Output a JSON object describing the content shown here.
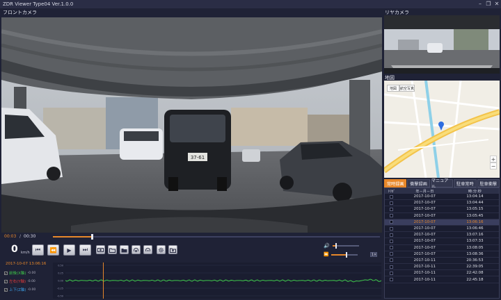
{
  "window": {
    "title": "ZDR Viewer Type04 Ver.1.0.0",
    "controls": {
      "minimize": "–",
      "restore": "❐",
      "close": "✕"
    }
  },
  "labels": {
    "front_camera": "フロントカメラ",
    "rear_camera": "リヤカメラ",
    "map": "地図"
  },
  "map": {
    "tab_map": "地図",
    "tab_satellite": "航空写真",
    "zoom_in": "+",
    "zoom_out": "−",
    "pin_color": "#2f6ee0"
  },
  "front_view": {
    "plate_text": "37-61"
  },
  "playback": {
    "current_time": "00:03",
    "separator": "/",
    "total_time": "00:30",
    "progress": 0.12,
    "speed": "0",
    "speed_unit": "km/h",
    "volume": 0.12,
    "rate": 0.55,
    "rate_label": "1×"
  },
  "buttons": {
    "prev": "⏮",
    "step_back": "⏪",
    "play": "▶",
    "next": "⏭"
  },
  "tabs": [
    {
      "label": "常時録画",
      "active": true
    },
    {
      "label": "衝撃録画",
      "active": false
    },
    {
      "label": "マニュアル",
      "active": false
    },
    {
      "label": "駐車常時",
      "active": false
    },
    {
      "label": "駐車衝撃",
      "active": false
    }
  ],
  "table": {
    "headers": [
      "ﾄﾘｶﾞ",
      "年－月－日",
      "時:分:秒"
    ],
    "rows": [
      {
        "date": "2017-10-07",
        "time": "13:04:14",
        "selected": false
      },
      {
        "date": "2017-10-07",
        "time": "13:04:44",
        "selected": false
      },
      {
        "date": "2017-10-07",
        "time": "13:05:15",
        "selected": false
      },
      {
        "date": "2017-10-07",
        "time": "13:05:45",
        "selected": false
      },
      {
        "date": "2017-10-07",
        "time": "13:06:16",
        "selected": true
      },
      {
        "date": "2017-10-07",
        "time": "13:06:46",
        "selected": false
      },
      {
        "date": "2017-10-07",
        "time": "13:07:16",
        "selected": false
      },
      {
        "date": "2017-10-07",
        "time": "13:07:33",
        "selected": false
      },
      {
        "date": "2017-10-07",
        "time": "13:08:05",
        "selected": false
      },
      {
        "date": "2017-10-07",
        "time": "13:08:36",
        "selected": false
      },
      {
        "date": "2017-10-11",
        "time": "20:36:53",
        "selected": false
      },
      {
        "date": "2017-10-11",
        "time": "22:39:05",
        "selected": false
      },
      {
        "date": "2017-10-11",
        "time": "22:42:08",
        "selected": false
      },
      {
        "date": "2017-10-11",
        "time": "22:45:18",
        "selected": false
      }
    ]
  },
  "sensor": {
    "datetime": "2017-10-07 13:06:16",
    "legend": [
      {
        "label": "前後(X軸)",
        "value": "-0.00",
        "color": "#3ec84a"
      },
      {
        "label": "左右(Y軸)",
        "value": "-0.00",
        "color": "#e03a3a"
      },
      {
        "label": "上下(Z軸)",
        "value": "-0.00",
        "color": "#3a9ae0"
      }
    ],
    "y_ticks": [
      "0.50",
      "0.25",
      "0.00",
      "-0.25",
      "-0.50"
    ],
    "cursor_position": 0.12
  }
}
